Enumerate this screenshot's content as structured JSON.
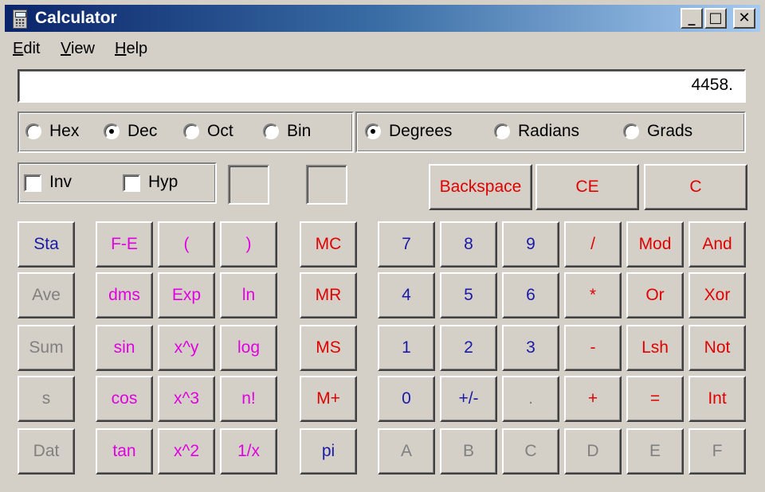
{
  "window": {
    "title": "Calculator",
    "controls": {
      "minimize": "_",
      "maximize": "□",
      "close": "✕"
    }
  },
  "menu": [
    {
      "label": "Edit",
      "accel": "E",
      "rest": "dit"
    },
    {
      "label": "View",
      "accel": "V",
      "rest": "iew"
    },
    {
      "label": "Help",
      "accel": "H",
      "rest": "elp"
    }
  ],
  "display": {
    "value": "4458."
  },
  "number_base": {
    "options": [
      "Hex",
      "Dec",
      "Oct",
      "Bin"
    ],
    "selected": "Dec"
  },
  "angle_mode": {
    "options": [
      "Degrees",
      "Radians",
      "Grads"
    ],
    "selected": "Degrees"
  },
  "modifiers": {
    "inv": {
      "label": "Inv",
      "checked": false
    },
    "hyp": {
      "label": "Hyp",
      "checked": false
    }
  },
  "edit_buttons": [
    "Backspace",
    "CE",
    "C"
  ],
  "stat_buttons": [
    "Sta",
    "Ave",
    "Sum",
    "s",
    "Dat"
  ],
  "function_buttons": [
    [
      "F-E",
      "(",
      ")"
    ],
    [
      "dms",
      "Exp",
      "ln"
    ],
    [
      "sin",
      "x^y",
      "log"
    ],
    [
      "cos",
      "x^3",
      "n!"
    ],
    [
      "tan",
      "x^2",
      "1/x"
    ]
  ],
  "memory_buttons": [
    "MC",
    "MR",
    "MS",
    "M+",
    "pi"
  ],
  "keypad": [
    [
      "7",
      "8",
      "9",
      "/",
      "Mod",
      "And"
    ],
    [
      "4",
      "5",
      "6",
      "*",
      "Or",
      "Xor"
    ],
    [
      "1",
      "2",
      "3",
      "-",
      "Lsh",
      "Not"
    ],
    [
      "0",
      "+/-",
      ".",
      "+",
      "=",
      "Int"
    ],
    [
      "A",
      "B",
      "C",
      "D",
      "E",
      "F"
    ]
  ],
  "colors": {
    "face": "#d4d0c8",
    "operator_red": "#e00000",
    "digit_blue": "#1a1aa8",
    "function_magenta": "#e000e0",
    "disabled_gray": "#808080",
    "titlebar_start": "#0a246a",
    "titlebar_end": "#a6caf0"
  },
  "icons": {
    "app": "calculator-icon"
  }
}
